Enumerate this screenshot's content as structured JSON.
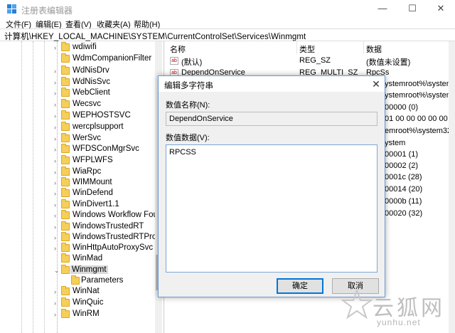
{
  "window": {
    "title": "注册表编辑器",
    "minimize": "—",
    "maximize": "☐",
    "close": "✕"
  },
  "menu": [
    "文件(F)",
    "编辑(E)",
    "查看(V)",
    "收藏夹(A)",
    "帮助(H)"
  ],
  "address": "计算机\\HKEY_LOCAL_MACHINE\\SYSTEM\\CurrentControlSet\\Services\\Winmgmt",
  "tree": {
    "items": [
      {
        "label": "wdiwifi",
        "expander": "›"
      },
      {
        "label": "WdmCompanionFilter",
        "expander": ""
      },
      {
        "label": "WdNisDrv",
        "expander": "›"
      },
      {
        "label": "WdNisSvc",
        "expander": "›"
      },
      {
        "label": "WebClient",
        "expander": "›"
      },
      {
        "label": "Wecsvc",
        "expander": "›"
      },
      {
        "label": "WEPHOSTSVC",
        "expander": "›"
      },
      {
        "label": "wercplsupport",
        "expander": "›"
      },
      {
        "label": "WerSvc",
        "expander": "›"
      },
      {
        "label": "WFDSConMgrSvc",
        "expander": "›"
      },
      {
        "label": "WFPLWFS",
        "expander": "›"
      },
      {
        "label": "WiaRpc",
        "expander": "›"
      },
      {
        "label": "WIMMount",
        "expander": "›"
      },
      {
        "label": "WinDefend",
        "expander": "›"
      },
      {
        "label": "WinDivert1.1",
        "expander": "›"
      },
      {
        "label": "Windows Workflow Foun",
        "expander": "›"
      },
      {
        "label": "WindowsTrustedRT",
        "expander": "›"
      },
      {
        "label": "WindowsTrustedRTProxy",
        "expander": "›"
      },
      {
        "label": "WinHttpAutoProxySvc",
        "expander": "›"
      },
      {
        "label": "WinMad",
        "expander": ""
      },
      {
        "label": "Winmgmt",
        "expander": "⌄",
        "selected": true
      },
      {
        "label": "Parameters",
        "expander": "",
        "child": true
      },
      {
        "label": "WinNat",
        "expander": "›"
      },
      {
        "label": "WinQuic",
        "expander": "›"
      },
      {
        "label": "WinRM",
        "expander": "›"
      }
    ]
  },
  "list": {
    "headers": {
      "name": "名称",
      "type": "类型",
      "data": "数据"
    },
    "rows": [
      {
        "icon": "ab",
        "name": "(默认)",
        "type": "REG_SZ",
        "data": "(数值未设置)"
      },
      {
        "icon": "ab",
        "name": "DependOnService",
        "type": "REG_MULTI_SZ",
        "data": "RpcSs"
      },
      {
        "icon": "",
        "name": "",
        "type": "",
        "data": "ystemroot%\\system3"
      },
      {
        "icon": "",
        "name": "",
        "type": "",
        "data": "ystemroot%\\system3"
      },
      {
        "icon": "",
        "name": "",
        "type": "",
        "data": "00000 (0)"
      },
      {
        "icon": "",
        "name": "",
        "type": "",
        "data": "01 00 00 00 00 00 0"
      },
      {
        "icon": "",
        "name": "",
        "type": "",
        "data": "emroot%\\system32\\"
      },
      {
        "icon": "",
        "name": "",
        "type": "",
        "data": "ystem"
      },
      {
        "icon": "",
        "name": "",
        "type": "",
        "data": "00001 (1)"
      },
      {
        "icon": "",
        "name": "",
        "type": "",
        "data": "00002 (2)"
      },
      {
        "icon": "",
        "name": "",
        "type": "",
        "data": "0001c (28)"
      },
      {
        "icon": "",
        "name": "",
        "type": "",
        "data": "00014 (20)"
      },
      {
        "icon": "",
        "name": "",
        "type": "",
        "data": "0000b (11)"
      },
      {
        "icon": "",
        "name": "",
        "type": "",
        "data": "00020 (32)"
      }
    ]
  },
  "dialog": {
    "title": "编辑多字符串",
    "close": "✕",
    "name_label": "数值名称(N):",
    "name_value": "DependOnService",
    "data_label": "数值数据(V):",
    "data_value": "RPCSS",
    "ok": "确定",
    "cancel": "取消"
  },
  "watermark": {
    "cn": "云狐网",
    "url": "yunhu.net"
  },
  "colors": {
    "folder": "#f5cf59",
    "accent": "#0078d7",
    "selection": "#d9d9d9"
  }
}
